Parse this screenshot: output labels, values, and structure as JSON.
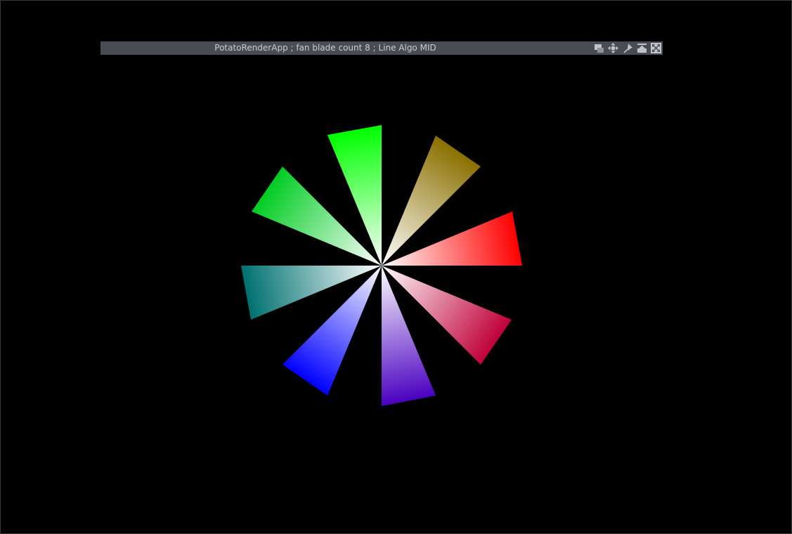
{
  "window": {
    "title": "PotatoRenderApp ; fan blade count 8 ; Line Algo MID",
    "controls": [
      {
        "name": "restore-window-icon"
      },
      {
        "name": "move-window-icon"
      },
      {
        "name": "pin-icon"
      },
      {
        "name": "minimize-to-top-icon"
      },
      {
        "name": "fullscreen-icon"
      }
    ]
  },
  "colors": {
    "background": "#000000",
    "titlebar": "#474c55",
    "title_text": "#c9ccd2",
    "icon": "#c0c3c8",
    "center": "#ffffff"
  },
  "fan": {
    "blade_count": 8,
    "blades": [
      {
        "name": "blade-green-top",
        "color": "#00ff00"
      },
      {
        "name": "blade-olive-top-right",
        "color": "#8a7000"
      },
      {
        "name": "blade-red-right",
        "color": "#ff0000"
      },
      {
        "name": "blade-crimson-bottom-right",
        "color": "#c0003a"
      },
      {
        "name": "blade-purple-bottom",
        "color": "#4a00c0"
      },
      {
        "name": "blade-blue-bottom-left",
        "color": "#0000ff"
      },
      {
        "name": "blade-teal-left",
        "color": "#007070"
      },
      {
        "name": "blade-green-top-left",
        "color": "#00cc22"
      }
    ]
  }
}
